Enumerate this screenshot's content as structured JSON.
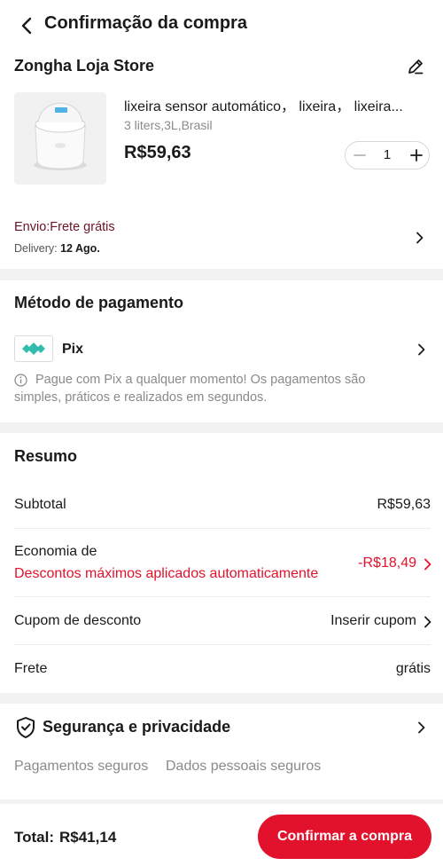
{
  "header": {
    "title": "Confirmação da compra"
  },
  "store": {
    "name": "Zongha Loja Store"
  },
  "product": {
    "title": "lixeira sensor automático， lixeira， lixeira...",
    "variant": "3 liters,3L,Brasil",
    "price": "R$59,63",
    "quantity": "1"
  },
  "shipping": {
    "label": "Envio:Frete grátis",
    "delivery_label": "Delivery:",
    "delivery_date": "12 Ago."
  },
  "payment": {
    "title": "Método de pagamento",
    "method": "Pix",
    "info": "Pague com Pix a qualquer momento! Os pagamentos são simples, práticos e realizados em segundos."
  },
  "summary": {
    "title": "Resumo",
    "subtotal_label": "Subtotal",
    "subtotal_value": "R$59,63",
    "savings_label": "Economia de",
    "savings_detail": "Descontos máximos aplicados automaticamente",
    "savings_value": "-R$18,49",
    "coupon_label": "Cupom de desconto",
    "coupon_value": "Inserir cupom",
    "freight_label": "Frete",
    "freight_value": "grátis"
  },
  "security": {
    "title": "Segurança e privacidade",
    "item1": "Pagamentos seguros",
    "item2": "Dados pessoais seguros"
  },
  "footer": {
    "total_label": "Total:",
    "total_value": "R$41,14",
    "confirm_label": "Confirmar a compra"
  },
  "colors": {
    "accent": "#e3122c",
    "shipping_text": "#6b1226",
    "pix": "#32bcad"
  }
}
